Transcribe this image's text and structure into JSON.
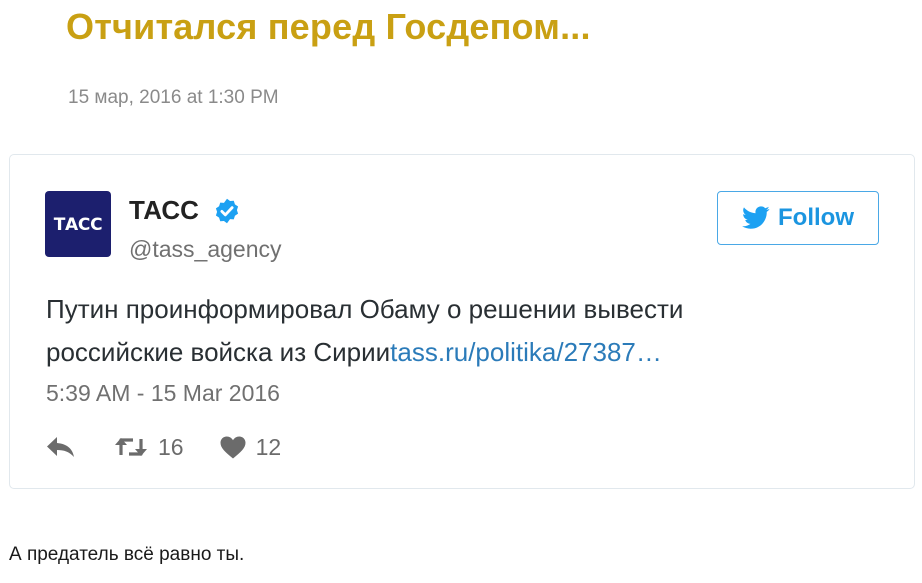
{
  "post": {
    "title": "Отчитался перед Госдепом...",
    "date": "15 мар, 2016 at 1:30 PM"
  },
  "tweet": {
    "avatar_text": "ТАСС",
    "account_name": "ТАСС",
    "handle": "@tass_agency",
    "follow_label": "Follow",
    "text": "Путин проинформировал Обаму о решении вывести российские войска из Сирии",
    "link_text": "tass.ru/politika/27387…",
    "timestamp": "5:39 AM - 15 Mar 2016",
    "retweet_count": "16",
    "like_count": "12",
    "icons": {
      "verified": "verified-badge-icon",
      "follow": "twitter-bird-icon",
      "reply": "reply-icon",
      "retweet": "retweet-icon",
      "like": "heart-icon"
    },
    "colors": {
      "link": "#2b7bb9",
      "verified": "#1da1f2",
      "follow": "#1b95e0",
      "avatar_bg": "#1c1f6e"
    }
  },
  "comment": {
    "text": "А предатель всё равно ты."
  },
  "colors": {
    "title": "#c9a013"
  }
}
